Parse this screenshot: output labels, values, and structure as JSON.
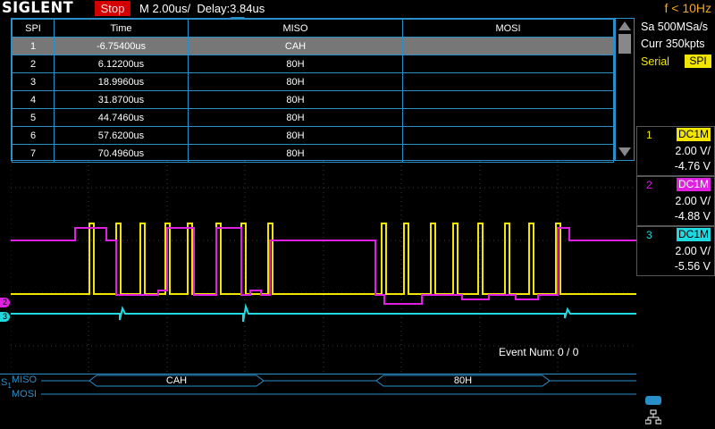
{
  "header": {
    "brand": "SIGLENT",
    "run_state": "Stop",
    "timebase": "M 2.00us/",
    "delay": "Delay:3.84us",
    "trigger_freq": "f < 10Hz"
  },
  "acquisition": {
    "sample_rate": "Sa 500MSa/s",
    "memory": "Curr 350kpts",
    "trigger_type": "Serial",
    "trigger_source": "SPI"
  },
  "channels": [
    {
      "num": "1",
      "coupling": "DC1M",
      "scale": "2.00 V/",
      "offset": "-4.76 V",
      "color": "#f2e600"
    },
    {
      "num": "2",
      "coupling": "DC1M",
      "scale": "2.00 V/",
      "offset": "-4.88 V",
      "color": "#e020e0"
    },
    {
      "num": "3",
      "coupling": "DC1M",
      "scale": "2.00 V/",
      "offset": "-5.56 V",
      "color": "#20d8e0"
    }
  ],
  "decode_table": {
    "headers": [
      "SPI",
      "Time",
      "MISO",
      "MOSI"
    ],
    "rows": [
      {
        "index": "1",
        "time": "-6.75400us",
        "miso": "CAH",
        "mosi": ""
      },
      {
        "index": "2",
        "time": "6.12200us",
        "miso": "80H",
        "mosi": ""
      },
      {
        "index": "3",
        "time": "18.9960us",
        "miso": "80H",
        "mosi": ""
      },
      {
        "index": "4",
        "time": "31.8700us",
        "miso": "80H",
        "mosi": ""
      },
      {
        "index": "5",
        "time": "44.7460us",
        "miso": "80H",
        "mosi": ""
      },
      {
        "index": "6",
        "time": "57.6200us",
        "miso": "80H",
        "mosi": ""
      },
      {
        "index": "7",
        "time": "70.4960us",
        "miso": "80H",
        "mosi": ""
      }
    ]
  },
  "event_num": "Event Num: 0 / 0",
  "bus": {
    "label": "S",
    "label_sub": "1",
    "miso_label": "MISO",
    "mosi_label": "MOSI",
    "miso_frames": [
      "CAH",
      "80H"
    ]
  },
  "markers": {
    "ch2_marker": "2",
    "ch3_marker": "3"
  }
}
